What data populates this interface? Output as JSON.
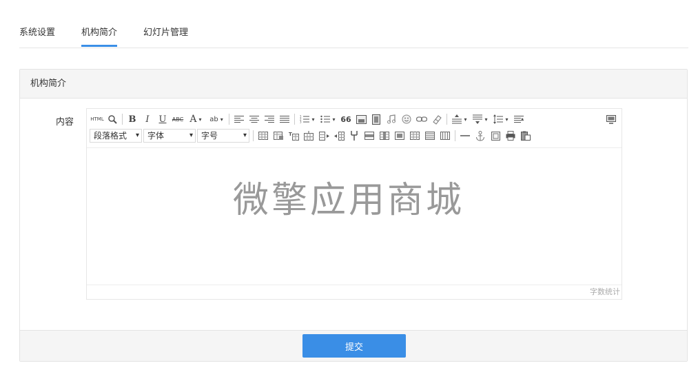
{
  "tabs": [
    {
      "label": "系统设置"
    },
    {
      "label": "机构简介"
    },
    {
      "label": "幻灯片管理"
    }
  ],
  "panel": {
    "title": "机构简介",
    "field_label": "内容"
  },
  "editor": {
    "toolbar": {
      "html_label": "HTML",
      "bold": "B",
      "italic": "I",
      "underline": "U",
      "strike": "ABC",
      "font_color": "A",
      "backcolor": "ab",
      "quote": "66",
      "paragraph_select": "段落格式",
      "font_select": "字体",
      "size_select": "字号"
    },
    "watermark": "微擎应用商城",
    "word_count_label": "字数统计"
  },
  "footer": {
    "submit_label": "提交"
  },
  "colors": {
    "accent": "#3a8ee6"
  }
}
